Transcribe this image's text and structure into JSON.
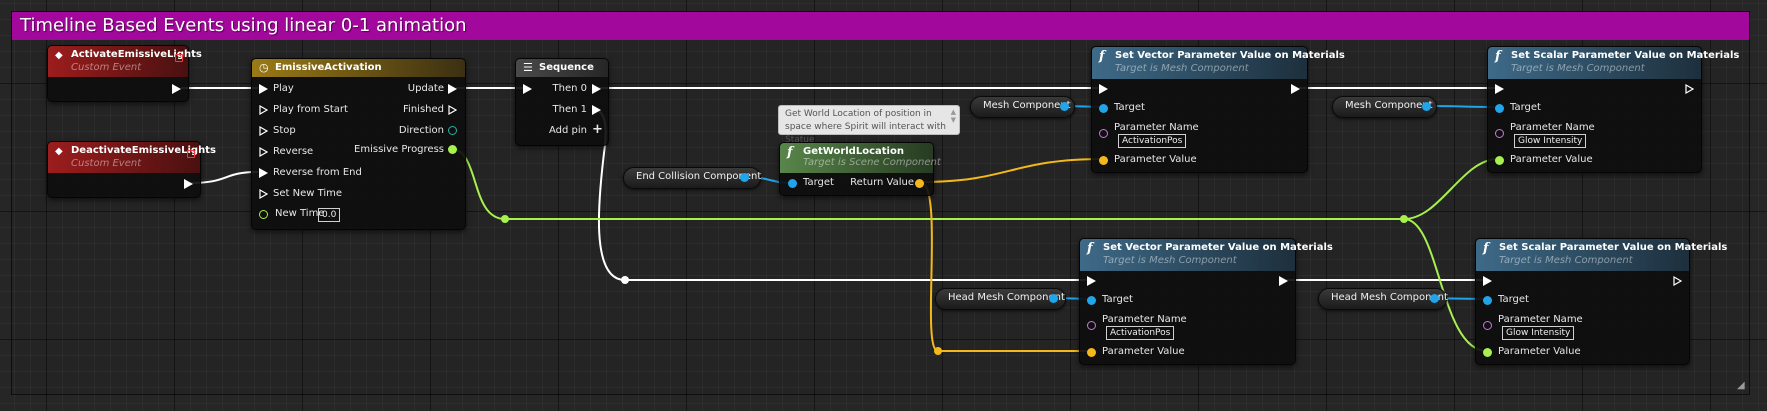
{
  "comment": {
    "title": "Timeline Based Events using linear 0-1 animation"
  },
  "colors": {
    "comment": "#a2089c",
    "exec": "#ffffff",
    "float": "#a7f04d",
    "vector": "#f4b81c",
    "object": "#20a4ea",
    "name": "#c77ad6",
    "event": "#8b1a1a",
    "timeline": "#8f7115",
    "function": "#3b5d75",
    "pure_function": "#4c6e3e"
  },
  "events": [
    {
      "title": "ActivateEmissiveLights",
      "subtitle": "Custom Event"
    },
    {
      "title": "DeactivateEmissiveLights",
      "subtitle": "Custom Event"
    }
  ],
  "timeline": {
    "title": "EmissiveActivation",
    "inputs": [
      "Play",
      "Play from Start",
      "Stop",
      "Reverse",
      "Reverse from End",
      "Set New Time",
      "New Time"
    ],
    "new_time_value": "0.0",
    "outputs": [
      "Update",
      "Finished",
      "Direction",
      "Emissive Progress"
    ]
  },
  "sequence": {
    "title": "Sequence",
    "outputs": [
      "Then 0",
      "Then 1"
    ],
    "add_pin": "Add pin"
  },
  "tooltip": {
    "text": "Get World Location of position in space where Spirit will interact with Statue"
  },
  "get_world_location": {
    "title": "GetWorldLocation",
    "subtitle": "Target is Scene Component",
    "input": "Target",
    "output": "Return Value"
  },
  "variables": {
    "end_collision": "End Collision Component",
    "mesh": "Mesh Component",
    "head_mesh": "Head Mesh Component"
  },
  "function_nodes": [
    {
      "title": "Set Vector Parameter Value on Materials",
      "subtitle": "Target is Mesh Component",
      "target": "Target",
      "param_name_label": "Parameter Name",
      "param_name": "ActivationPos",
      "param_value": "Parameter Value"
    },
    {
      "title": "Set Scalar Parameter Value on Materials",
      "subtitle": "Target is Mesh Component",
      "target": "Target",
      "param_name_label": "Parameter Name",
      "param_name": "Glow Intensity",
      "param_value": "Parameter Value"
    },
    {
      "title": "Set Vector Parameter Value on Materials",
      "subtitle": "Target is Mesh Component",
      "target": "Target",
      "param_name_label": "Parameter Name",
      "param_name": "ActivationPos",
      "param_value": "Parameter Value"
    },
    {
      "title": "Set Scalar Parameter Value on Materials",
      "subtitle": "Target is Mesh Component",
      "target": "Target",
      "param_name_label": "Parameter Name",
      "param_name": "Glow Intensity",
      "param_value": "Parameter Value"
    }
  ]
}
